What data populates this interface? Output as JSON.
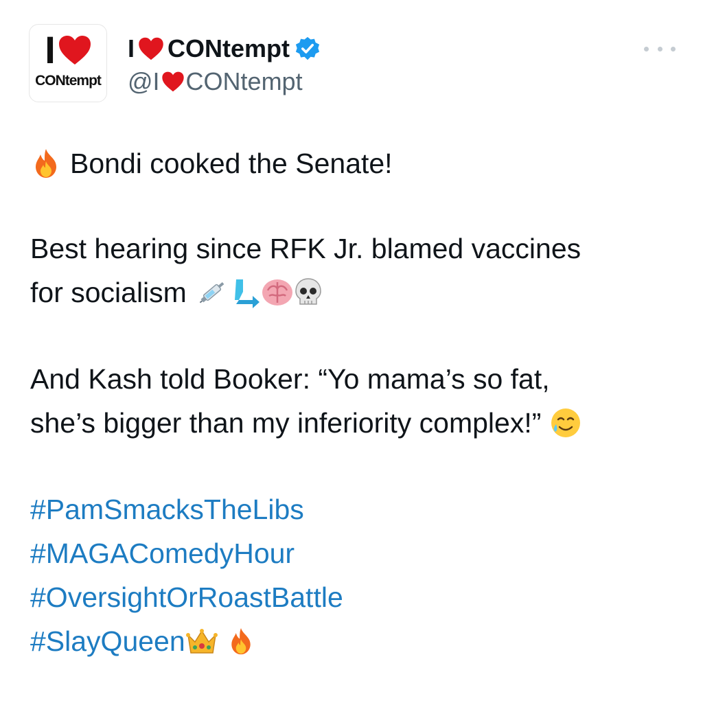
{
  "account": {
    "avatar_top": "I",
    "avatar_word": "CONtempt",
    "display_name_prefix": "I",
    "display_name_suffix": "CONtempt",
    "handle_prefix": "@I",
    "handle_suffix": "CONtempt",
    "verified": true
  },
  "tweet": {
    "line1": "Bondi cooked the Senate!",
    "line2": "Best hearing since RFK Jr. blamed vaccines",
    "line3": "for socialism",
    "line4": "And Kash told Booker: “Yo mama’s so fat,",
    "line5": "she’s bigger than my inferiority complex!”",
    "hashtags": [
      "#PamSmacksTheLibs",
      "#MAGAComedyHour",
      "#OversightOrRoastBattle",
      "#SlayQueen"
    ]
  },
  "colors": {
    "heart": "#e0161e",
    "verified": "#1d9bf0",
    "hashtag": "#1d7cc2",
    "handle": "#536471"
  },
  "icons": [
    "heart-icon",
    "verified-badge-icon",
    "more-icon",
    "fire-icon",
    "syringe-icon",
    "arrow-icon",
    "brain-icon",
    "skull-icon",
    "smiling-tear-icon",
    "crown-icon"
  ]
}
